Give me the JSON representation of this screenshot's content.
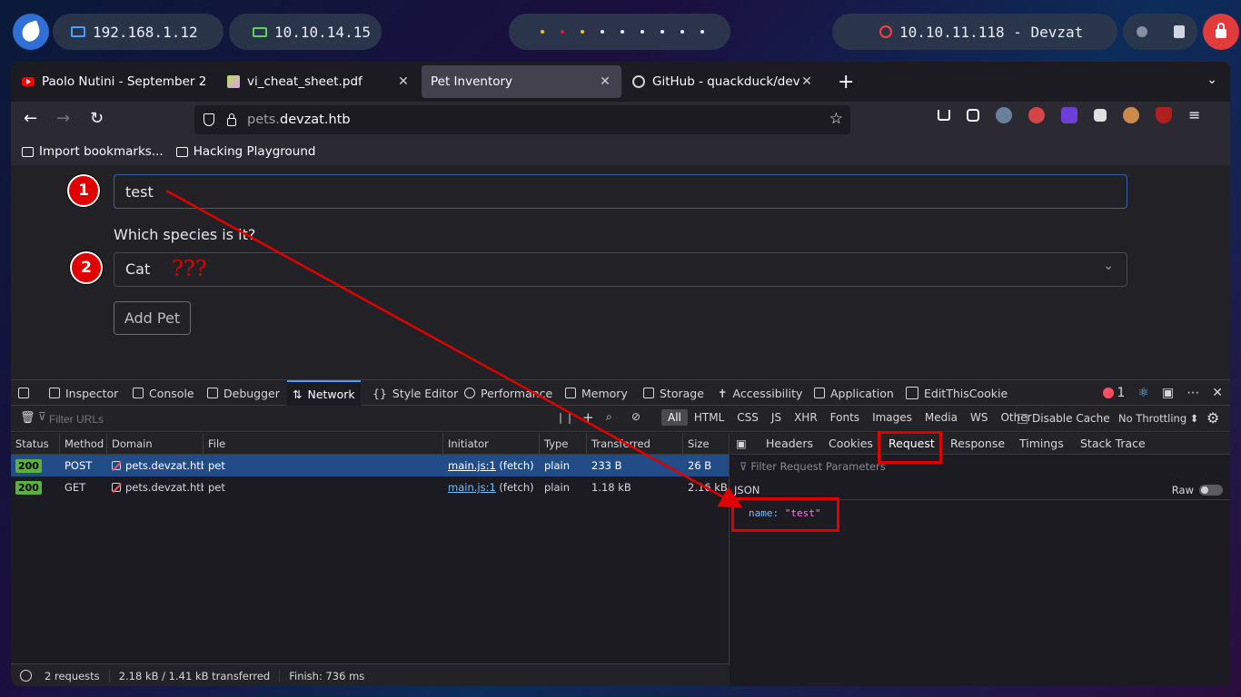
{
  "system_bar": {
    "ip_local": "192.168.1.12",
    "ip_vpn": "10.10.14.15",
    "target": "10.10.11.118 - Devzat",
    "workspace_dot_colors": [
      "#f5c211",
      "#e01b24",
      "#f5c211",
      "#e8ecf5",
      "#e8ecf5",
      "#e8ecf5",
      "#e8ecf5",
      "#e8ecf5",
      "#e8ecf5"
    ]
  },
  "browser": {
    "tabs": [
      {
        "title": "Paolo Nutini - September 2",
        "icon": "youtube-icon"
      },
      {
        "title": "vi_cheat_sheet.pdf",
        "icon": "pdf-icon"
      },
      {
        "title": "Pet Inventory",
        "icon": "",
        "active": true
      },
      {
        "title": "GitHub - quackduck/devza",
        "icon": "github-icon"
      }
    ],
    "url_host_dim": "pets.",
    "url_host": "devzat.htb",
    "bookmarks": [
      "Import bookmarks...",
      "Hacking Playground"
    ]
  },
  "page": {
    "badge_1": "1",
    "badge_2": "2",
    "name_value": "test",
    "species_label": "Which species is it?",
    "species_value": "Cat",
    "annotation": "???",
    "add_pet": "Add Pet"
  },
  "devtools": {
    "tabs": [
      "Inspector",
      "Console",
      "Debugger",
      "Network",
      "Style Editor",
      "Performance",
      "Memory",
      "Storage",
      "Accessibility",
      "Application",
      "EditThisCookie"
    ],
    "active_tab": "Network",
    "error_count": "1",
    "filter_placeholder": "Filter URLs",
    "type_filters": [
      "All",
      "HTML",
      "CSS",
      "JS",
      "XHR",
      "Fonts",
      "Images",
      "Media",
      "WS",
      "Other"
    ],
    "disable_cache": "Disable Cache",
    "throttling": "No Throttling ⬍",
    "columns": [
      "Status",
      "Method",
      "Domain",
      "File",
      "Initiator",
      "Type",
      "Transferred",
      "Size"
    ],
    "requests": [
      {
        "status": "200",
        "method": "POST",
        "domain": "pets.devzat.htb",
        "file": "pet",
        "initiator_link": "main.js:1",
        "initiator_rest": " (fetch)",
        "type": "plain",
        "transferred": "233 B",
        "size": "26 B"
      },
      {
        "status": "200",
        "method": "GET",
        "domain": "pets.devzat.htb",
        "file": "pet",
        "initiator_link": "main.js:1",
        "initiator_rest": " (fetch)",
        "type": "plain",
        "transferred": "1.18 kB",
        "size": "2.16 kB"
      }
    ],
    "summary": {
      "requests": "2 requests",
      "transferred": "2.18 kB / 1.41 kB transferred",
      "finish": "Finish: 736 ms"
    },
    "detail_tabs": [
      "Headers",
      "Cookies",
      "Request",
      "Response",
      "Timings",
      "Stack Trace"
    ],
    "detail_active": "Request",
    "filter_params": "Filter Request Parameters",
    "json_label": "JSON",
    "raw_label": "Raw",
    "json_key": "name:",
    "json_value": "\"test\""
  },
  "colors": {
    "annotation_red": "#e00000",
    "accent_blue": "#4b9cff",
    "status_ok": "#5ab13d"
  }
}
